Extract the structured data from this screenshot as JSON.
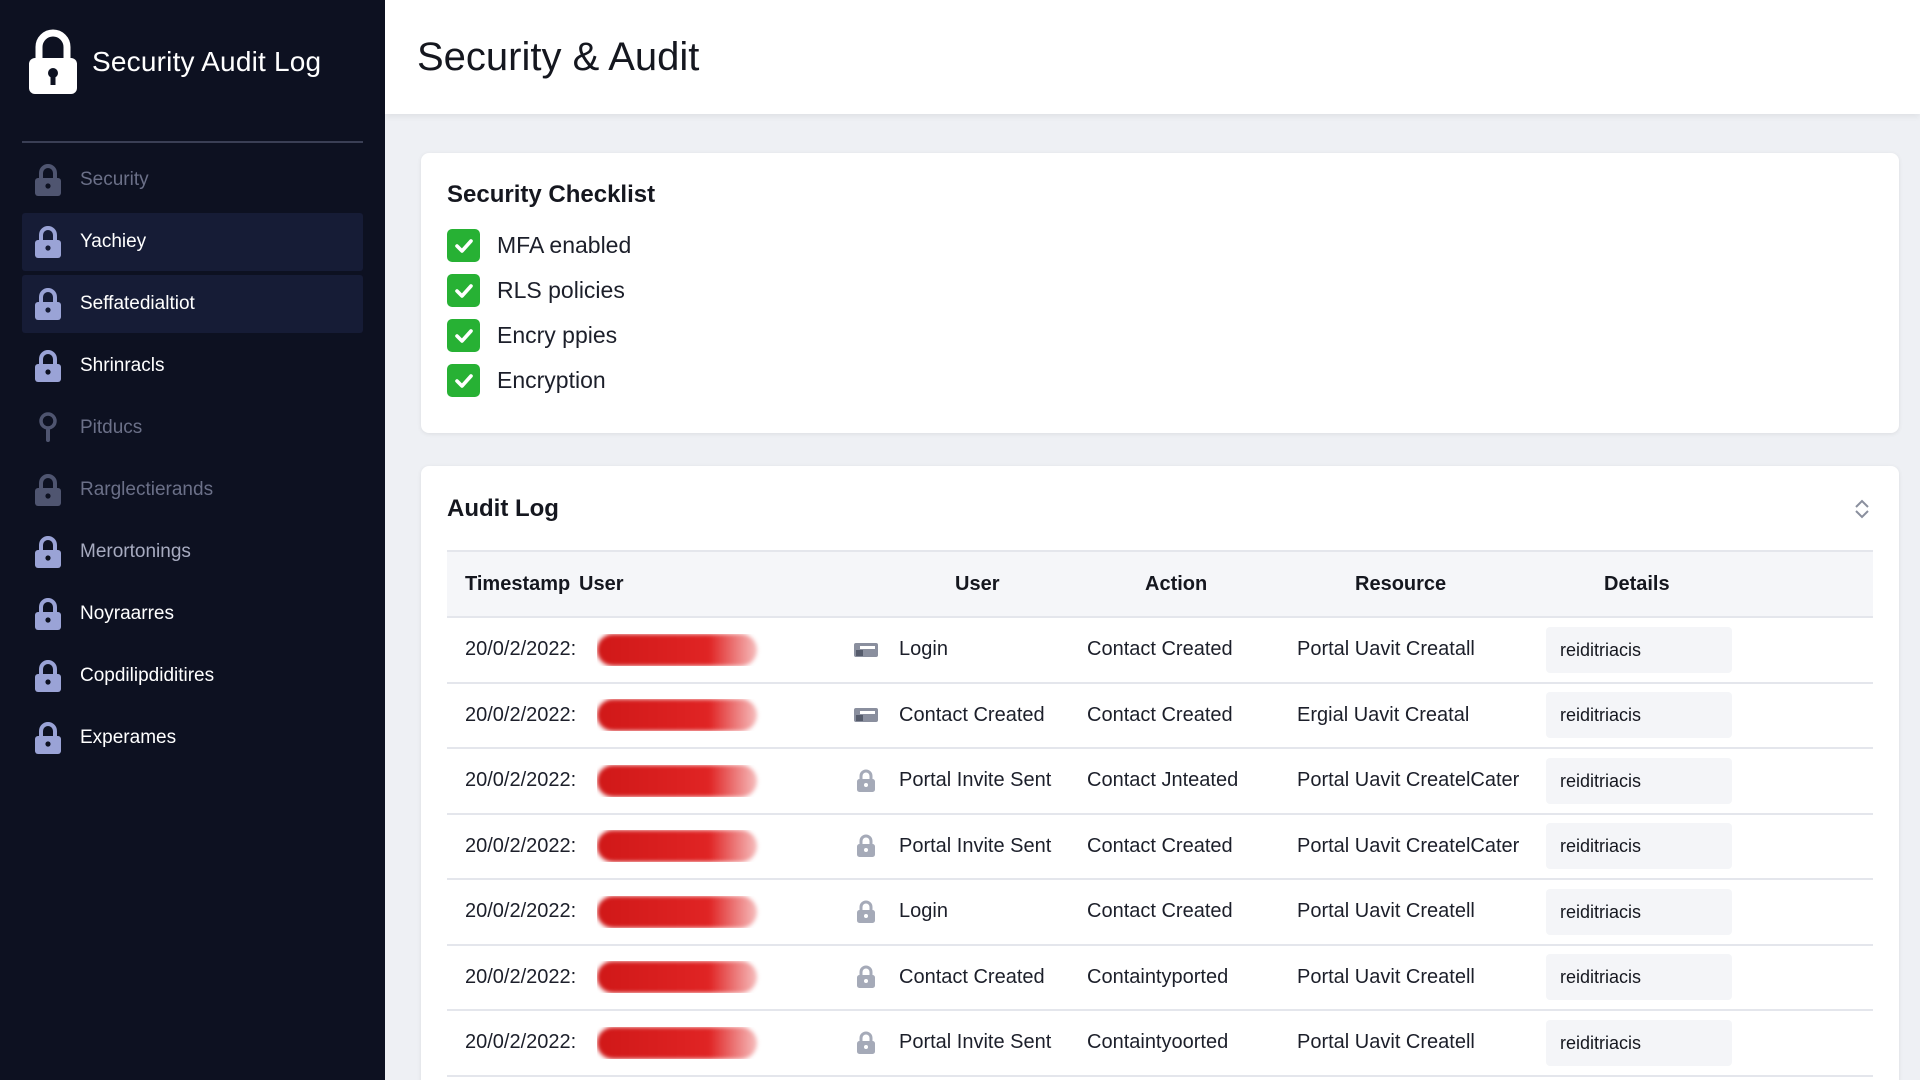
{
  "sidebar": {
    "title": "Security Audit Log",
    "items": [
      {
        "label": "Security",
        "icon": "lock-icon",
        "state": "dim"
      },
      {
        "label": "Yachiey",
        "icon": "lock-icon",
        "state": "active"
      },
      {
        "label": "Seffatedialtiot",
        "icon": "lock-icon",
        "state": "active"
      },
      {
        "label": "Shrinracls",
        "icon": "lock-icon",
        "state": "normal"
      },
      {
        "label": "Pitducs",
        "icon": "pin-icon",
        "state": "dim"
      },
      {
        "label": "Rarglectierands",
        "icon": "lock-icon",
        "state": "dim"
      },
      {
        "label": "Merortonings",
        "icon": "lock-icon",
        "state": "dim"
      },
      {
        "label": "Noyraarres",
        "icon": "lock-icon",
        "state": "normal"
      },
      {
        "label": "Copdilipdiditires",
        "icon": "lock-icon",
        "state": "normal"
      },
      {
        "label": "Experames",
        "icon": "lock-icon",
        "state": "normal"
      }
    ]
  },
  "header": {
    "title": "Security & Audit"
  },
  "checklist": {
    "title": "Security Checklist",
    "items": [
      "MFA enabled",
      "RLS policies",
      "Encry ppies",
      "Encryption"
    ]
  },
  "audit": {
    "title": "Audit Log",
    "columns": [
      "Timestamp",
      "User",
      "User",
      "Action",
      "Resource",
      "Details"
    ],
    "rows": [
      {
        "timestamp": "20/0/2/2022:",
        "icon": "card-icon",
        "user": "Login",
        "action": "Contact Created",
        "resource": "Portal Uavit Creatall",
        "details": "reiditriacis"
      },
      {
        "timestamp": "20/0/2/2022:",
        "icon": "card-icon",
        "user": "Contact Created",
        "action": "Contact Created",
        "resource": "Ergial Uavit Creatal",
        "details": "reiditriacis"
      },
      {
        "timestamp": "20/0/2/2022:",
        "icon": "lock-icon",
        "user": "Portal Invite Sent",
        "action": "Contact Jnteated",
        "resource": "Portal Uavit CreatelCater",
        "details": "reiditriacis"
      },
      {
        "timestamp": "20/0/2/2022:",
        "icon": "lock-icon",
        "user": "Portal Invite Sent",
        "action": "Contact Created",
        "resource": "Portal Uavit CreatelCater",
        "details": "reiditriacis"
      },
      {
        "timestamp": "20/0/2/2022:",
        "icon": "lock-icon",
        "user": "Login",
        "action": "Contact Created",
        "resource": "Portal Uavit Createll",
        "details": "reiditriacis"
      },
      {
        "timestamp": "20/0/2/2022:",
        "icon": "lock-icon",
        "user": "Contact Created",
        "action": "Containtyported",
        "resource": "Portal Uavit Createll",
        "details": "reiditriacis"
      },
      {
        "timestamp": "20/0/2/2022:",
        "icon": "lock-icon",
        "user": "Portal Invite Sent",
        "action": "Containtyoorted",
        "resource": "Portal Uavit Createll",
        "details": "reiditriacis"
      }
    ]
  },
  "colors": {
    "sidebar_bg": "#0d1121",
    "check_green": "#27b134",
    "redaction": "#d01818",
    "icon_lavender": "#9aa3d6"
  }
}
